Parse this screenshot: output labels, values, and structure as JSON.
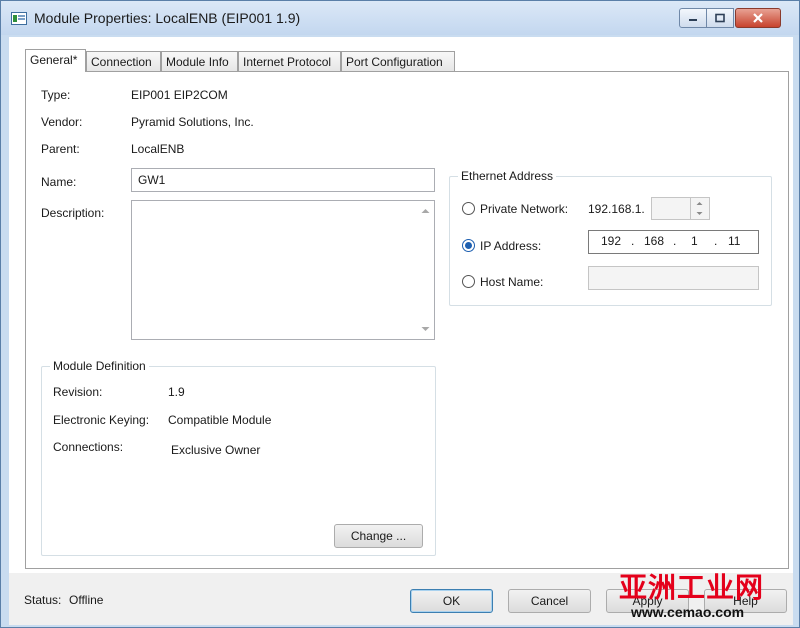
{
  "window": {
    "title": "Module Properties: LocalENB (EIP001 1.9)"
  },
  "tabs": [
    {
      "label": "General*"
    },
    {
      "label": "Connection"
    },
    {
      "label": "Module Info"
    },
    {
      "label": "Internet Protocol"
    },
    {
      "label": "Port Configuration"
    }
  ],
  "general": {
    "type_label": "Type:",
    "type_value": "EIP001 EIP2COM",
    "vendor_label": "Vendor:",
    "vendor_value": "Pyramid Solutions, Inc.",
    "parent_label": "Parent:",
    "parent_value": "LocalENB",
    "name_label": "Name:",
    "name_value": "GW1",
    "description_label": "Description:",
    "description_value": ""
  },
  "module_definition": {
    "title": "Module Definition",
    "revision_label": "Revision:",
    "revision_value": "1.9",
    "keying_label": "Electronic Keying:",
    "keying_value": "Compatible Module",
    "connections_label": "Connections:",
    "connections_value": "Exclusive Owner",
    "change_label": "Change ..."
  },
  "ethernet": {
    "title": "Ethernet Address",
    "private_network_label": "Private Network:",
    "private_network_prefix": "192.168.1.",
    "private_network_value": "",
    "ip_address_label": "IP Address:",
    "ip_octets": [
      "192",
      "168",
      "1",
      "11"
    ],
    "ip_separator": ".",
    "host_name_label": "Host Name:",
    "host_name_value": "",
    "selected": "ip_address"
  },
  "footer": {
    "status_label": "Status:",
    "status_value": "Offline",
    "ok_label": "OK",
    "cancel_label": "Cancel",
    "apply_label": "Apply",
    "help_label": "Help"
  },
  "watermark": {
    "chinese": "亚洲工业网",
    "site": "www.cemao.com"
  }
}
